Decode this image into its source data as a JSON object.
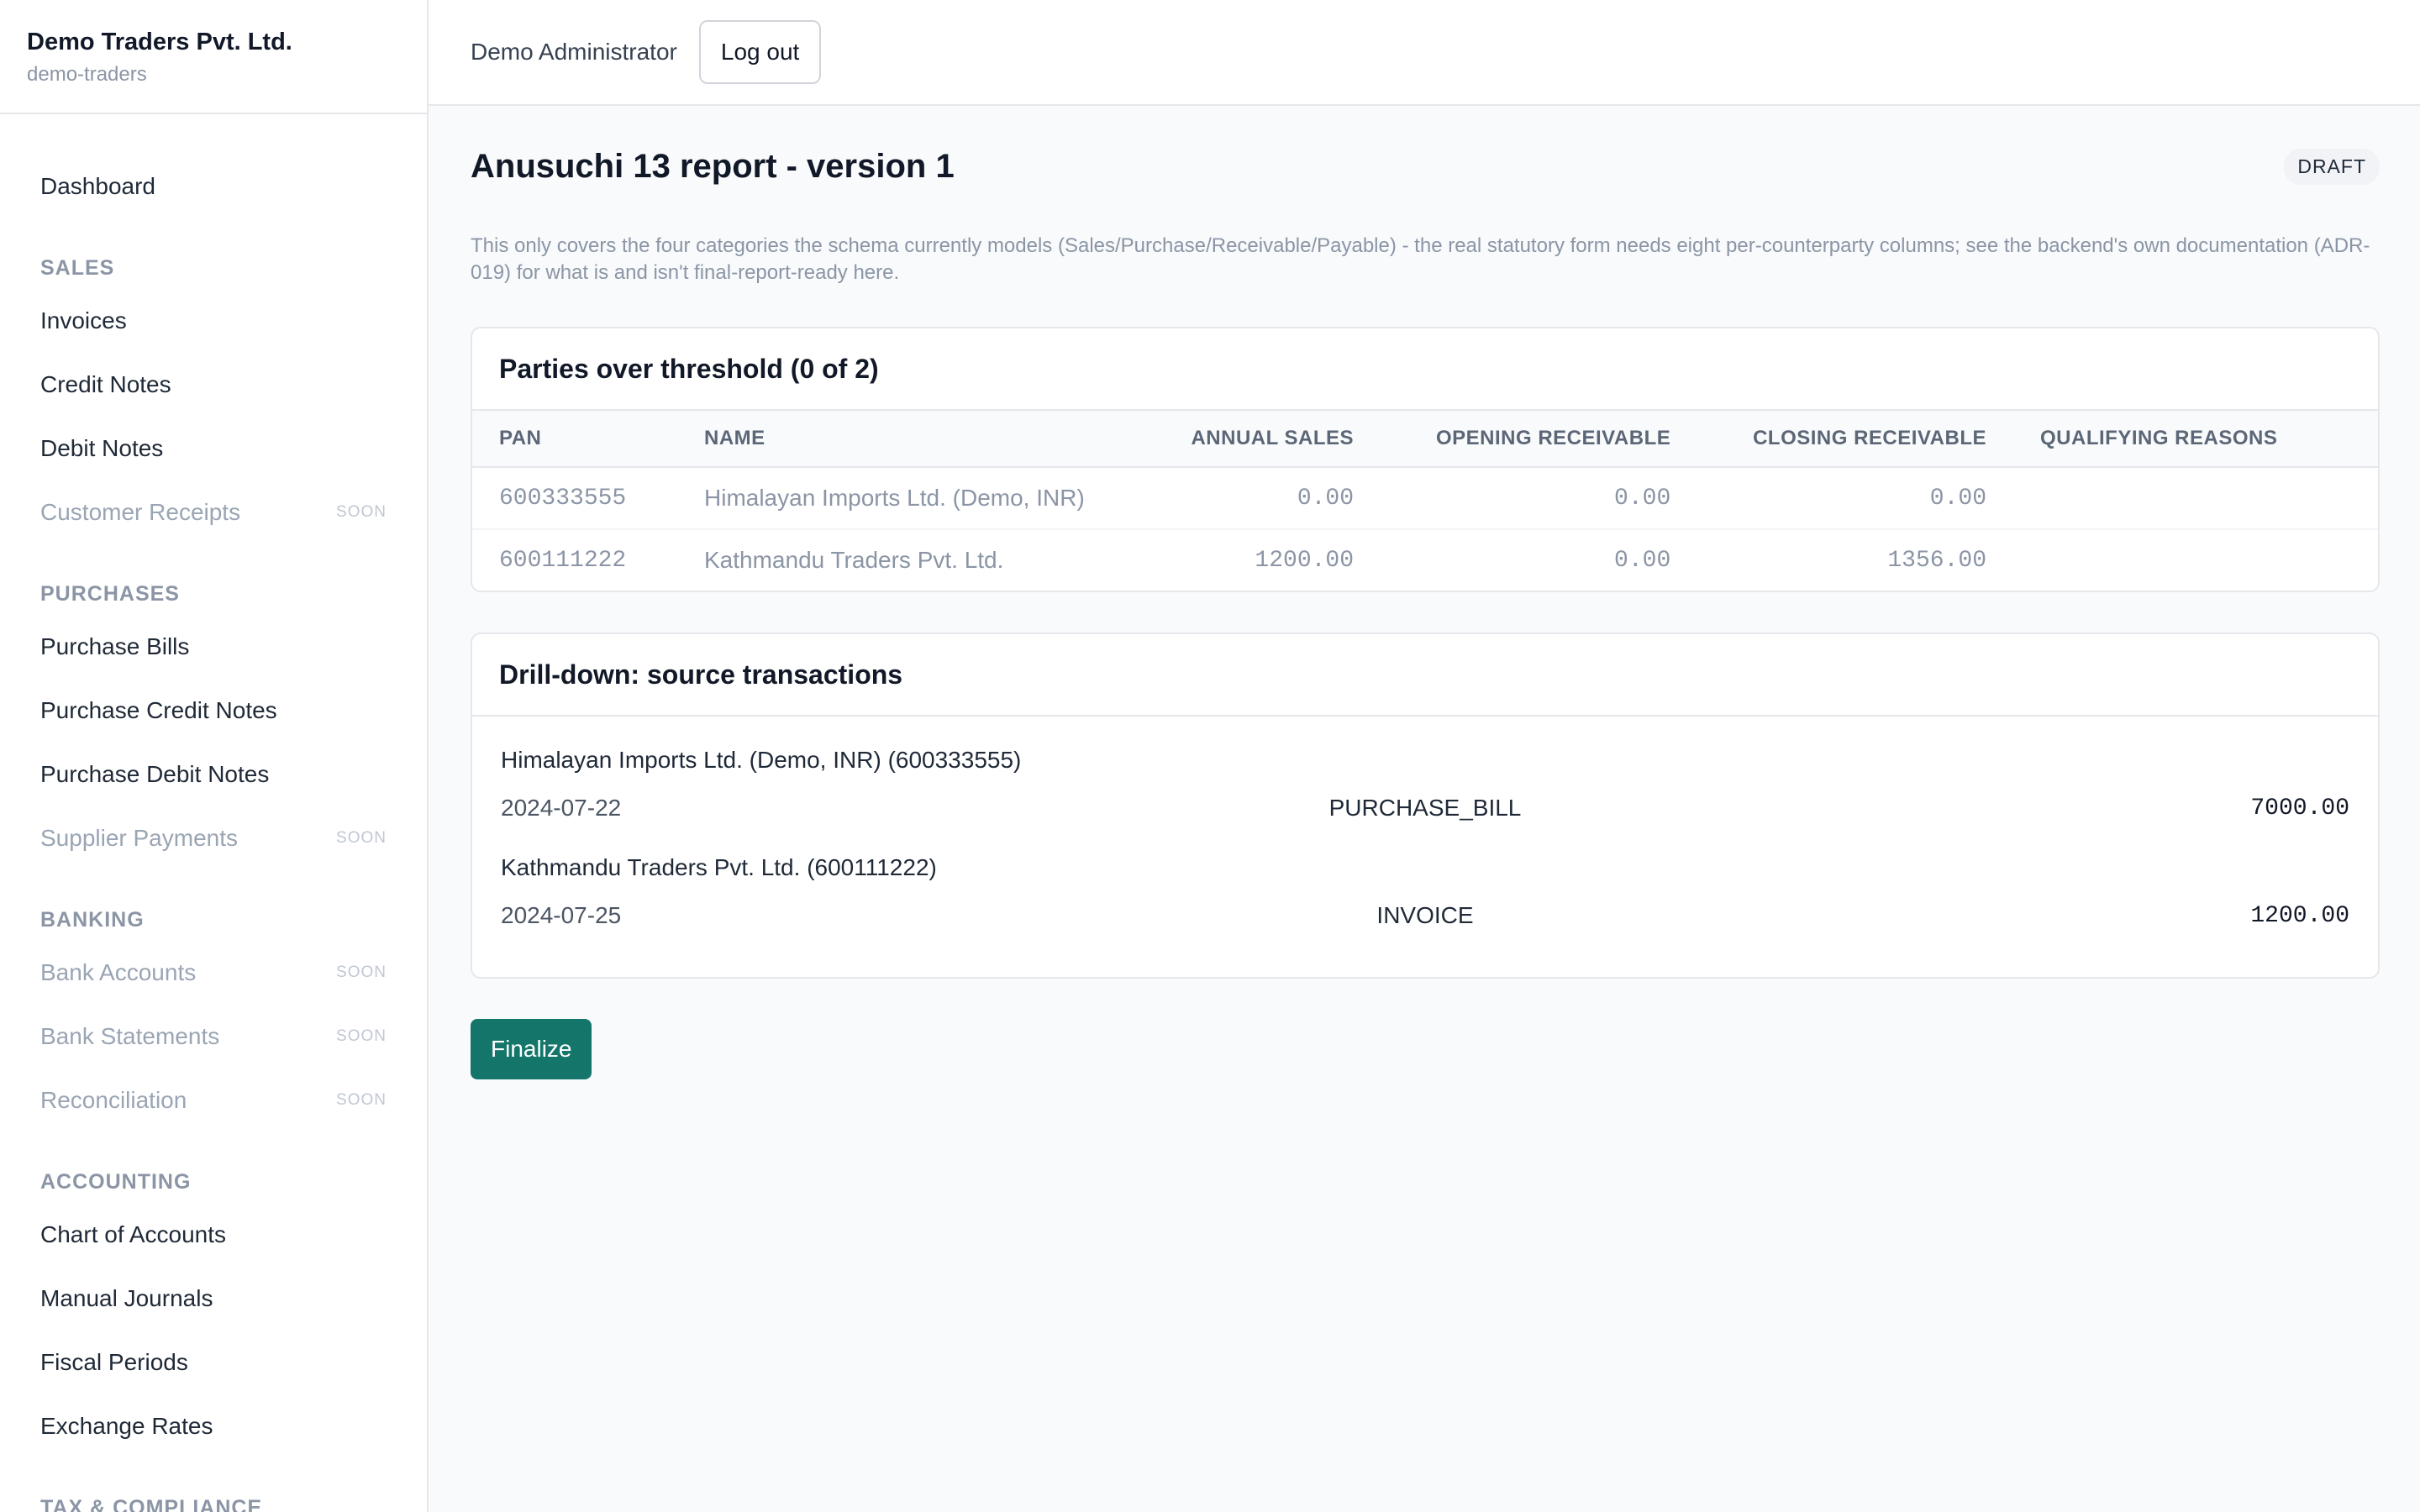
{
  "sidebar": {
    "brand_name": "Demo Traders Pvt. Ltd.",
    "brand_slug": "demo-traders",
    "dashboard": "Dashboard",
    "soon_label": "SOON",
    "sections": {
      "sales": "SALES",
      "purchases": "PURCHASES",
      "banking": "BANKING",
      "accounting": "ACCOUNTING",
      "tax": "TAX & COMPLIANCE"
    },
    "sales_items": [
      "Invoices",
      "Credit Notes",
      "Debit Notes",
      "Customer Receipts"
    ],
    "purchase_items": [
      "Purchase Bills",
      "Purchase Credit Notes",
      "Purchase Debit Notes",
      "Supplier Payments"
    ],
    "banking_items": [
      "Bank Accounts",
      "Bank Statements",
      "Reconciliation"
    ],
    "accounting_items": [
      "Chart of Accounts",
      "Manual Journals",
      "Fiscal Periods",
      "Exchange Rates"
    ]
  },
  "topbar": {
    "user_name": "Demo Administrator",
    "logout_label": "Log out"
  },
  "page": {
    "title": "Anusuchi 13 report - version 1",
    "status": "DRAFT",
    "note": "This only covers the four categories the schema currently models (Sales/Purchase/Receivable/Payable) - the real statutory form needs eight per-counterparty columns; see the backend's own documentation (ADR-019) for what is and isn't final-report-ready here."
  },
  "parties": {
    "heading": "Parties over threshold (0 of 2)",
    "columns": [
      "PAN",
      "NAME",
      "ANNUAL SALES",
      "OPENING RECEIVABLE",
      "CLOSING RECEIVABLE",
      "QUALIFYING REASONS"
    ],
    "rows": [
      {
        "pan": "600333555",
        "name": "Himalayan Imports Ltd. (Demo, INR)",
        "annual_sales": "0.00",
        "opening": "0.00",
        "closing": "0.00",
        "reasons": ""
      },
      {
        "pan": "600111222",
        "name": "Kathmandu Traders Pvt. Ltd.",
        "annual_sales": "1200.00",
        "opening": "0.00",
        "closing": "1356.00",
        "reasons": ""
      }
    ]
  },
  "drilldown": {
    "heading": "Drill-down: source transactions",
    "groups": [
      {
        "party": "Himalayan Imports Ltd. (Demo, INR) (600333555)",
        "date": "2024-07-22",
        "type": "PURCHASE_BILL",
        "amount": "7000.00"
      },
      {
        "party": "Kathmandu Traders Pvt. Ltd. (600111222)",
        "date": "2024-07-25",
        "type": "INVOICE",
        "amount": "1200.00"
      }
    ]
  },
  "actions": {
    "finalize_label": "Finalize"
  },
  "colors": {
    "accent": "#14766b",
    "sidebar_bg": "#ffffff",
    "page_bg": "#f8fafc"
  }
}
